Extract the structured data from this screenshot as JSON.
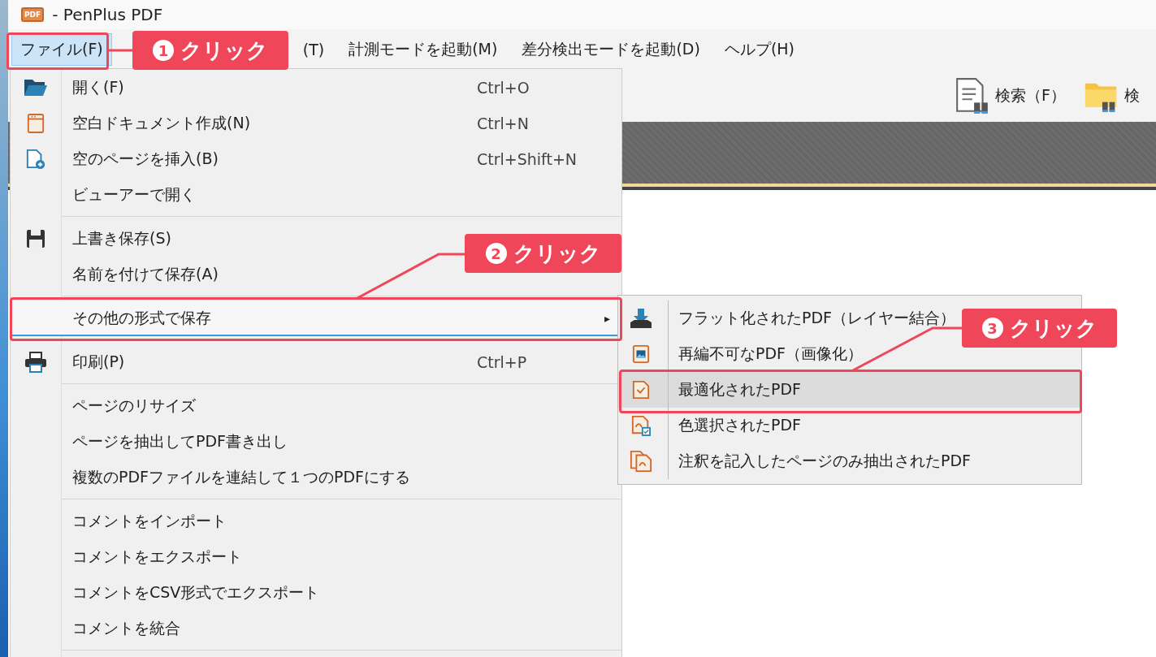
{
  "window": {
    "title": "- PenPlus PDF",
    "app_icon_text": "PDF"
  },
  "menubar": [
    {
      "label": "ファイル(F)",
      "selected": true
    },
    {
      "label": "(T)",
      "selected": false
    },
    {
      "label": "計測モードを起動(M)",
      "selected": false
    },
    {
      "label": "差分検出モードを起動(D)",
      "selected": false
    },
    {
      "label": "ヘルプ(H)",
      "selected": false
    }
  ],
  "toolbar": [
    {
      "label": "検索（F）"
    },
    {
      "label": "検"
    }
  ],
  "file_menu": {
    "groups": [
      [
        {
          "label": "開く(F)",
          "shortcut": "Ctrl+O",
          "selected": false
        },
        {
          "label": "空白ドキュメント作成(N)",
          "shortcut": "Ctrl+N",
          "selected": false
        },
        {
          "label": "空のページを挿入(B)",
          "shortcut": "Ctrl+Shift+N",
          "selected": false
        },
        {
          "label": "ビューアーで開く",
          "selected": false
        }
      ],
      [
        {
          "label": "上書き保存(S)",
          "selected": false
        },
        {
          "label": "名前を付けて保存(A)",
          "selected": false
        }
      ],
      [
        {
          "label": "その他の形式で保存",
          "selected": true,
          "submenu_arrow": "▸"
        }
      ],
      [
        {
          "label": "印刷(P)",
          "shortcut": "Ctrl+P",
          "selected": false
        }
      ],
      [
        {
          "label": "ページのリサイズ",
          "selected": false
        },
        {
          "label": "ページを抽出してPDF書き出し",
          "selected": false
        },
        {
          "label": "複数のPDFファイルを連結して１つのPDFにする",
          "selected": false
        }
      ],
      [
        {
          "label": "コメントをインポート",
          "selected": false
        },
        {
          "label": "コメントをエクスポート",
          "selected": false
        },
        {
          "label": "コメントをCSV形式でエクスポート",
          "selected": false
        },
        {
          "label": "コメントを統合",
          "selected": false
        }
      ]
    ]
  },
  "submenu": [
    {
      "label": "フラット化されたPDF（レイヤー結合）",
      "selected": false
    },
    {
      "label": "再編不可なPDF（画像化）",
      "selected": false
    },
    {
      "label": "最適化されたPDF",
      "selected": true
    },
    {
      "label": "色選択されたPDF",
      "selected": false
    },
    {
      "label": "注釈を記入したページのみ抽出されたPDF",
      "selected": false
    }
  ],
  "callouts": [
    {
      "number": "1",
      "label": "クリック"
    },
    {
      "number": "2",
      "label": "クリック"
    },
    {
      "number": "3",
      "label": "クリック"
    }
  ]
}
